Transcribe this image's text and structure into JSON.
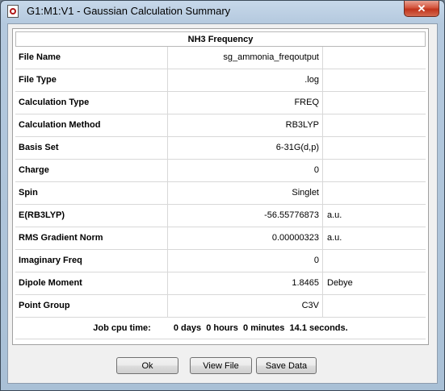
{
  "window": {
    "title": "G1:M1:V1 - Gaussian Calculation Summary",
    "close_label": "✕"
  },
  "table": {
    "title": "NH3 Frequency",
    "rows": [
      {
        "label": "File Name",
        "value": "sg_ammonia_freqoutput",
        "unit": ""
      },
      {
        "label": "File Type",
        "value": ".log",
        "unit": ""
      },
      {
        "label": "Calculation Type",
        "value": "FREQ",
        "unit": ""
      },
      {
        "label": "Calculation Method",
        "value": "RB3LYP",
        "unit": ""
      },
      {
        "label": "Basis Set",
        "value": "6-31G(d,p)",
        "unit": ""
      },
      {
        "label": "Charge",
        "value": "0",
        "unit": ""
      },
      {
        "label": "Spin",
        "value": "Singlet",
        "unit": ""
      },
      {
        "label": "E(RB3LYP)",
        "value": "-56.55776873",
        "unit": "a.u."
      },
      {
        "label": "RMS Gradient Norm",
        "value": "0.00000323",
        "unit": "a.u."
      },
      {
        "label": "Imaginary Freq",
        "value": "0",
        "unit": ""
      },
      {
        "label": "Dipole Moment",
        "value": "1.8465",
        "unit": "Debye"
      },
      {
        "label": "Point Group",
        "value": "C3V",
        "unit": ""
      }
    ],
    "cpu_time": {
      "label": "Job cpu time:",
      "days": "0 days",
      "hours": "0 hours",
      "minutes": "0 minutes",
      "seconds": "14.1 seconds."
    }
  },
  "buttons": {
    "ok": "Ok",
    "view_file": "View File",
    "save_data": "Save Data"
  }
}
